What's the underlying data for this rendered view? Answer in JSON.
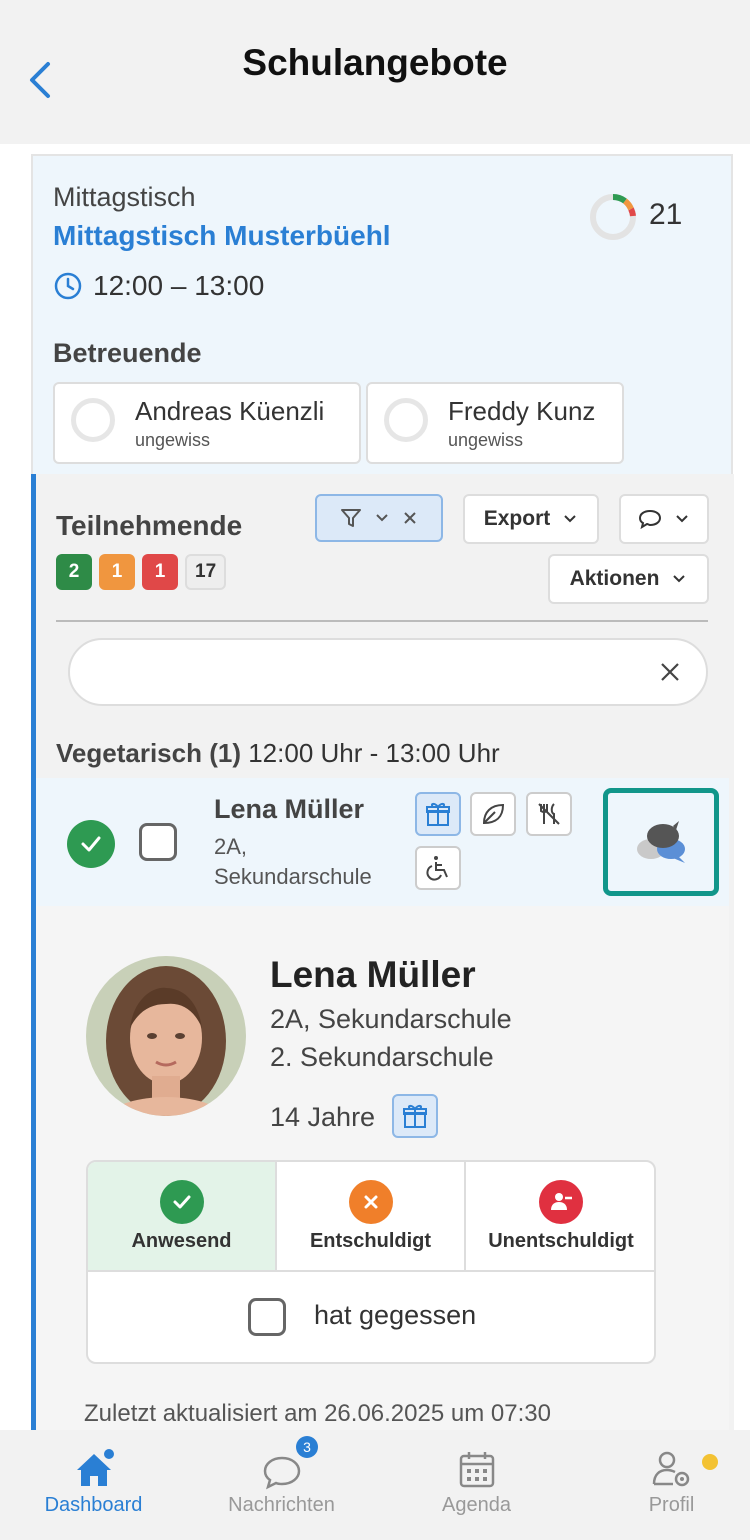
{
  "header": {
    "title": "Schulangebote"
  },
  "offer": {
    "category": "Mittagstisch",
    "name": "Mittagstisch Musterbüehl",
    "time": "12:00 – 13:00",
    "count": "21"
  },
  "staff": {
    "heading": "Betreuende",
    "items": [
      {
        "name": "Andreas Küenzli",
        "status": "ungewiss"
      },
      {
        "name": "Freddy Kunz",
        "status": "ungewiss"
      }
    ]
  },
  "participants": {
    "heading": "Teilnehmende",
    "badges": [
      {
        "value": "2",
        "color": "#2e8b47"
      },
      {
        "value": "1",
        "color": "#f0963f"
      },
      {
        "value": "1",
        "color": "#e04848"
      },
      {
        "value": "17",
        "color": "#eeeeee"
      }
    ],
    "export_label": "Export",
    "actions_label": "Aktionen",
    "group_title": "Vegetarisch (1)",
    "group_time": "12:00 Uhr - 13:00 Uhr"
  },
  "student": {
    "name": "Lena Müller",
    "class_line1": "2A,",
    "class_line2": "Sekundarschule",
    "detail_line1": "2A, Sekundarschule",
    "detail_line2": "2. Sekundarschule",
    "age": "14 Jahre",
    "icons": [
      "gift-icon",
      "leaf-icon",
      "no-cutlery-icon",
      "wheelchair-icon",
      "chat-bubbles-icon"
    ]
  },
  "attendance": {
    "present": "Anwesend",
    "excused": "Entschuldigt",
    "unexcused": "Unentschuldigt",
    "ate": "hat gegessen",
    "colors": {
      "present": "#2e9a52",
      "excused": "#f07f2a",
      "unexcused": "#e03040"
    }
  },
  "updated": "Zuletzt aktualisiert am 26.06.2025 um 07:30",
  "tabs": {
    "dashboard": "Dashboard",
    "messages": "Nachrichten",
    "messages_badge": "3",
    "agenda": "Agenda",
    "profile": "Profil"
  },
  "colors": {
    "accent": "#2a7fd4",
    "highlight": "#11968a"
  }
}
